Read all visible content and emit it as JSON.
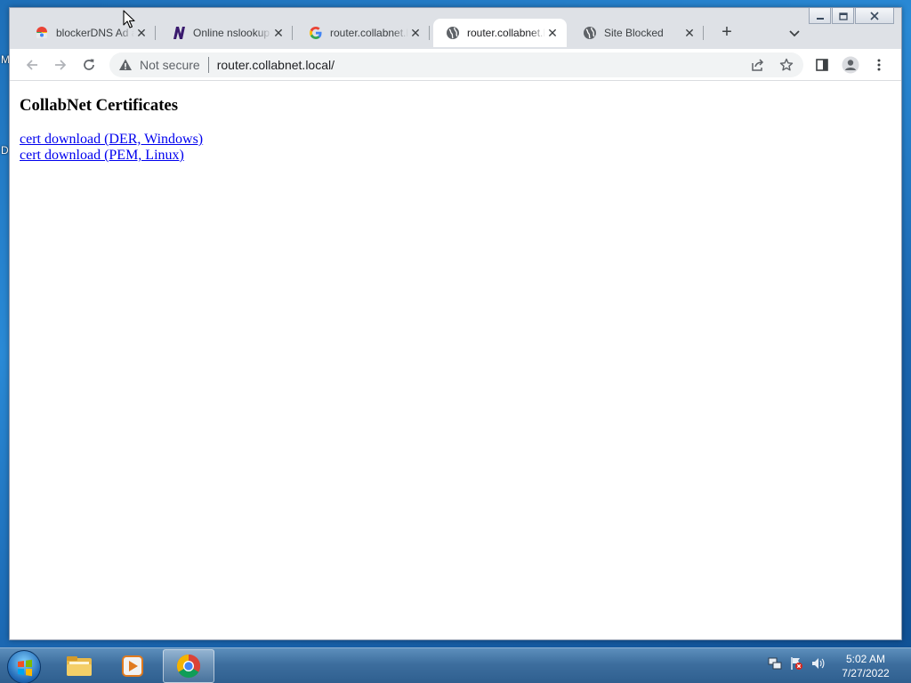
{
  "desktop": {
    "fragment_top": "M",
    "fragment_bottom": "D"
  },
  "tabs": [
    {
      "title": "blockerDNS Ad a",
      "icon": "chrome-web-store-icon",
      "active": false
    },
    {
      "title": "Online nslookup",
      "icon": "n-logo-icon",
      "active": false
    },
    {
      "title": "router.collabnet.l",
      "icon": "google-g-icon",
      "active": false
    },
    {
      "title": "router.collabnet.l",
      "icon": "globe-icon",
      "active": true
    },
    {
      "title": "Site Blocked",
      "icon": "globe-icon",
      "active": false
    }
  ],
  "omnibox": {
    "security_label": "Not secure",
    "url": "router.collabnet.local/"
  },
  "page": {
    "heading": "CollabNet Certificates",
    "links": [
      "cert download (DER, Windows)",
      "cert download (PEM, Linux)"
    ]
  },
  "taskbar": {
    "apps": [
      "file-explorer-icon",
      "media-player-icon",
      "chrome-icon"
    ],
    "tray": [
      "network-icon",
      "action-center-flag-icon",
      "volume-icon"
    ]
  },
  "clock": {
    "time": "5:02 AM",
    "date": "7/27/2022"
  }
}
